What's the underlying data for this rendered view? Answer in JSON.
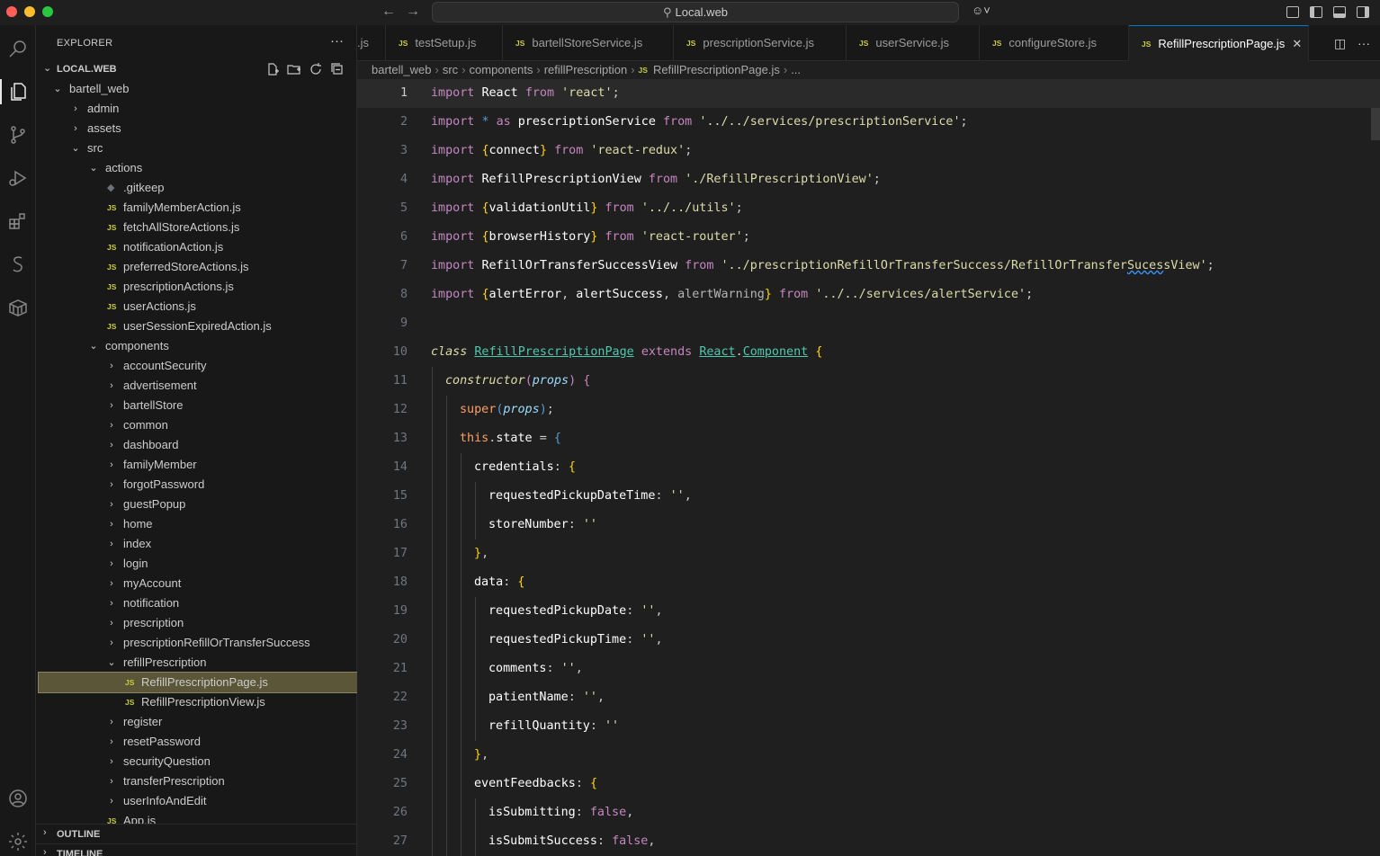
{
  "titlebar": {
    "search_text": "Local.web"
  },
  "sidebar": {
    "title": "EXPLORER",
    "workspace": "LOCAL.WEB",
    "outline": "OUTLINE",
    "timeline": "TIMELINE",
    "tree": [
      {
        "name": "bartell_web",
        "depth": 0,
        "type": "folder",
        "open": true
      },
      {
        "name": "admin",
        "depth": 1,
        "type": "folder",
        "open": false
      },
      {
        "name": "assets",
        "depth": 1,
        "type": "folder",
        "open": false
      },
      {
        "name": "src",
        "depth": 1,
        "type": "folder",
        "open": true
      },
      {
        "name": "actions",
        "depth": 2,
        "type": "folder",
        "open": true
      },
      {
        "name": ".gitkeep",
        "depth": 3,
        "type": "gitkeep"
      },
      {
        "name": "familyMemberAction.js",
        "depth": 3,
        "type": "js"
      },
      {
        "name": "fetchAllStoreActions.js",
        "depth": 3,
        "type": "js"
      },
      {
        "name": "notificationAction.js",
        "depth": 3,
        "type": "js"
      },
      {
        "name": "preferredStoreActions.js",
        "depth": 3,
        "type": "js"
      },
      {
        "name": "prescriptionActions.js",
        "depth": 3,
        "type": "js"
      },
      {
        "name": "userActions.js",
        "depth": 3,
        "type": "js"
      },
      {
        "name": "userSessionExpiredAction.js",
        "depth": 3,
        "type": "js"
      },
      {
        "name": "components",
        "depth": 2,
        "type": "folder",
        "open": true
      },
      {
        "name": "accountSecurity",
        "depth": 3,
        "type": "folder",
        "open": false
      },
      {
        "name": "advertisement",
        "depth": 3,
        "type": "folder",
        "open": false
      },
      {
        "name": "bartellStore",
        "depth": 3,
        "type": "folder",
        "open": false
      },
      {
        "name": "common",
        "depth": 3,
        "type": "folder",
        "open": false
      },
      {
        "name": "dashboard",
        "depth": 3,
        "type": "folder",
        "open": false
      },
      {
        "name": "familyMember",
        "depth": 3,
        "type": "folder",
        "open": false
      },
      {
        "name": "forgotPassword",
        "depth": 3,
        "type": "folder",
        "open": false
      },
      {
        "name": "guestPopup",
        "depth": 3,
        "type": "folder",
        "open": false
      },
      {
        "name": "home",
        "depth": 3,
        "type": "folder",
        "open": false
      },
      {
        "name": "index",
        "depth": 3,
        "type": "folder",
        "open": false
      },
      {
        "name": "login",
        "depth": 3,
        "type": "folder",
        "open": false
      },
      {
        "name": "myAccount",
        "depth": 3,
        "type": "folder",
        "open": false
      },
      {
        "name": "notification",
        "depth": 3,
        "type": "folder",
        "open": false
      },
      {
        "name": "prescription",
        "depth": 3,
        "type": "folder",
        "open": false
      },
      {
        "name": "prescriptionRefillOrTransferSuccess",
        "depth": 3,
        "type": "folder",
        "open": false
      },
      {
        "name": "refillPrescription",
        "depth": 3,
        "type": "folder",
        "open": true
      },
      {
        "name": "RefillPrescriptionPage.js",
        "depth": 4,
        "type": "js",
        "selected": true
      },
      {
        "name": "RefillPrescriptionView.js",
        "depth": 4,
        "type": "js"
      },
      {
        "name": "register",
        "depth": 3,
        "type": "folder",
        "open": false
      },
      {
        "name": "resetPassword",
        "depth": 3,
        "type": "folder",
        "open": false
      },
      {
        "name": "securityQuestion",
        "depth": 3,
        "type": "folder",
        "open": false
      },
      {
        "name": "transferPrescription",
        "depth": 3,
        "type": "folder",
        "open": false
      },
      {
        "name": "userInfoAndEdit",
        "depth": 3,
        "type": "folder",
        "open": false
      },
      {
        "name": "App.js",
        "depth": 3,
        "type": "js"
      }
    ]
  },
  "tabs": [
    {
      "label": ".js",
      "icon": "none"
    },
    {
      "label": "testSetup.js",
      "icon": "js"
    },
    {
      "label": "bartellStoreService.js",
      "icon": "js"
    },
    {
      "label": "prescriptionService.js",
      "icon": "js"
    },
    {
      "label": "userService.js",
      "icon": "js"
    },
    {
      "label": "configureStore.js",
      "icon": "js"
    },
    {
      "label": "RefillPrescriptionPage.js",
      "icon": "js",
      "active": true
    }
  ],
  "breadcrumb": [
    "bartell_web",
    "src",
    "components",
    "refillPrescription",
    "RefillPrescriptionPage.js",
    "..."
  ],
  "editor": {
    "current_line": 1,
    "lines": [
      [
        [
          "kw",
          "import "
        ],
        [
          "id",
          "React "
        ],
        [
          "kw",
          "from "
        ],
        [
          "str",
          "'react'"
        ],
        [
          "pu",
          ";"
        ]
      ],
      [
        [
          "kw",
          "import "
        ],
        [
          "k2",
          "* "
        ],
        [
          "kw",
          "as "
        ],
        [
          "id",
          "prescriptionService "
        ],
        [
          "kw",
          "from "
        ],
        [
          "str",
          "'../../services/prescriptionService'"
        ],
        [
          "pu",
          ";"
        ]
      ],
      [
        [
          "kw",
          "import "
        ],
        [
          "br",
          "{"
        ],
        [
          "id",
          "connect"
        ],
        [
          "br",
          "} "
        ],
        [
          "kw",
          "from "
        ],
        [
          "str",
          "'react-redux'"
        ],
        [
          "pu",
          ";"
        ]
      ],
      [
        [
          "kw",
          "import "
        ],
        [
          "id",
          "RefillPrescriptionView "
        ],
        [
          "kw",
          "from "
        ],
        [
          "str",
          "'./RefillPrescriptionView'"
        ],
        [
          "pu",
          ";"
        ]
      ],
      [
        [
          "kw",
          "import "
        ],
        [
          "br",
          "{"
        ],
        [
          "id",
          "validationUtil"
        ],
        [
          "br",
          "} "
        ],
        [
          "kw",
          "from "
        ],
        [
          "str",
          "'../../utils'"
        ],
        [
          "pu",
          ";"
        ]
      ],
      [
        [
          "kw",
          "import "
        ],
        [
          "br",
          "{"
        ],
        [
          "id",
          "browserHistory"
        ],
        [
          "br",
          "} "
        ],
        [
          "kw",
          "from "
        ],
        [
          "str",
          "'react-router'"
        ],
        [
          "pu",
          ";"
        ]
      ],
      [
        [
          "kw",
          "import "
        ],
        [
          "id",
          "RefillOrTransferSuccessView "
        ],
        [
          "kw",
          "from "
        ],
        [
          "str",
          "'../prescriptionRefillOrTransferSuccess/RefillOrTransfer"
        ],
        [
          "str wavy",
          "Suces"
        ],
        [
          "str",
          "sView'"
        ],
        [
          "pu",
          ";"
        ]
      ],
      [
        [
          "kw",
          "import "
        ],
        [
          "br",
          "{"
        ],
        [
          "id",
          "alertError"
        ],
        [
          "pu",
          ", "
        ],
        [
          "id",
          "alertSuccess"
        ],
        [
          "pu",
          ", "
        ],
        [
          "dim",
          "alertWarning"
        ],
        [
          "br",
          "} "
        ],
        [
          "kw",
          "from "
        ],
        [
          "str",
          "'../../services/alertService'"
        ],
        [
          "pu",
          ";"
        ]
      ],
      [],
      [
        [
          "k2 fnc",
          "class "
        ],
        [
          "cls und",
          "RefillPrescriptionPage"
        ],
        [
          "pu",
          " "
        ],
        [
          "kw",
          "extends "
        ],
        [
          "cls und",
          "React"
        ],
        [
          "pu",
          "."
        ],
        [
          "cls und",
          "Component"
        ],
        [
          "pu",
          " "
        ],
        [
          "br",
          "{"
        ]
      ],
      [
        [
          "fnc",
          "constructor"
        ],
        [
          "kw",
          "("
        ],
        [
          "par",
          "props"
        ],
        [
          "kw",
          ") "
        ],
        [
          "kw",
          "{"
        ]
      ],
      [
        [
          "sup",
          "super"
        ],
        [
          "k2",
          "("
        ],
        [
          "par",
          "props"
        ],
        [
          "k2",
          ")"
        ],
        [
          "pu",
          ";"
        ]
      ],
      [
        [
          "sup",
          "this"
        ],
        [
          "pu",
          "."
        ],
        [
          "id",
          "state "
        ],
        [
          "pu",
          "= "
        ],
        [
          "k2",
          "{"
        ]
      ],
      [
        [
          "id",
          "credentials"
        ],
        [
          "pu",
          ": "
        ],
        [
          "br",
          "{"
        ]
      ],
      [
        [
          "id",
          "requestedPickupDateTime"
        ],
        [
          "pu",
          ": "
        ],
        [
          "str",
          "''"
        ],
        [
          "pu",
          ","
        ]
      ],
      [
        [
          "id",
          "storeNumber"
        ],
        [
          "pu",
          ": "
        ],
        [
          "str",
          "''"
        ]
      ],
      [
        [
          "br",
          "}"
        ],
        [
          "pu",
          ","
        ]
      ],
      [
        [
          "id",
          "data"
        ],
        [
          "pu",
          ": "
        ],
        [
          "br",
          "{"
        ]
      ],
      [
        [
          "id",
          "requestedPickupDate"
        ],
        [
          "pu",
          ": "
        ],
        [
          "str",
          "''"
        ],
        [
          "pu",
          ","
        ]
      ],
      [
        [
          "id",
          "requestedPickupTime"
        ],
        [
          "pu",
          ": "
        ],
        [
          "str",
          "''"
        ],
        [
          "pu",
          ","
        ]
      ],
      [
        [
          "id",
          "comments"
        ],
        [
          "pu",
          ": "
        ],
        [
          "str",
          "''"
        ],
        [
          "pu",
          ","
        ]
      ],
      [
        [
          "id",
          "patientName"
        ],
        [
          "pu",
          ": "
        ],
        [
          "str",
          "''"
        ],
        [
          "pu",
          ","
        ]
      ],
      [
        [
          "id",
          "refillQuantity"
        ],
        [
          "pu",
          ": "
        ],
        [
          "str",
          "''"
        ]
      ],
      [
        [
          "br",
          "}"
        ],
        [
          "pu",
          ","
        ]
      ],
      [
        [
          "id",
          "eventFeedbacks"
        ],
        [
          "pu",
          ": "
        ],
        [
          "br",
          "{"
        ]
      ],
      [
        [
          "id",
          "isSubmitting"
        ],
        [
          "pu",
          ": "
        ],
        [
          "boo",
          "false"
        ],
        [
          "pu",
          ","
        ]
      ],
      [
        [
          "id",
          "isSubmitSuccess"
        ],
        [
          "pu",
          ": "
        ],
        [
          "boo",
          "false"
        ],
        [
          "pu",
          ","
        ]
      ]
    ],
    "indents": [
      0,
      0,
      0,
      0,
      0,
      0,
      0,
      0,
      0,
      0,
      1,
      2,
      2,
      3,
      4,
      4,
      3,
      3,
      4,
      4,
      4,
      4,
      4,
      3,
      3,
      4,
      4
    ]
  }
}
